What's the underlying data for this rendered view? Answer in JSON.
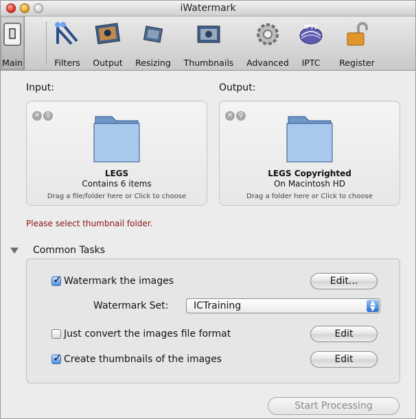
{
  "window": {
    "title": "iWatermark"
  },
  "toolbar": {
    "items": [
      {
        "label": "Main",
        "icon": "switch-icon"
      },
      {
        "label": "Filters",
        "icon": "filters-icon"
      },
      {
        "label": "Output",
        "icon": "output-photo-icon"
      },
      {
        "label": "Resizing",
        "icon": "resizing-icon"
      },
      {
        "label": "Thumbnails",
        "icon": "thumbnails-icon"
      },
      {
        "label": "Advanced",
        "icon": "gear-icon"
      },
      {
        "label": "IPTC",
        "icon": "iptc-icon",
        "badge": "IPTC"
      },
      {
        "label": "Register",
        "icon": "lock-icon"
      }
    ]
  },
  "input": {
    "label": "Input:",
    "name": "LEGS",
    "subtitle": "Contains 6 items",
    "hint": "Drag a file/folder here or Click to choose"
  },
  "output": {
    "label": "Output:",
    "name": "LEGS Copyrighted",
    "subtitle": "On Macintosh HD",
    "hint": "Drag a folder here or Click to choose"
  },
  "warning": "Please select thumbnail folder.",
  "common_tasks": {
    "title": "Common Tasks",
    "watermark": {
      "label": "Watermark the images",
      "checked": true,
      "button": "Edit..."
    },
    "watermark_set": {
      "label": "Watermark Set:",
      "value": "ICTraining"
    },
    "convert": {
      "label": "Just convert the images file format",
      "checked": false,
      "button": "Edit"
    },
    "thumbnails": {
      "label": "Create thumbnails of the images",
      "checked": true,
      "button": "Edit"
    }
  },
  "actions": {
    "start": "Start Processing"
  },
  "colors": {
    "warning": "#8b1414",
    "accent_blue": "#2b6ccf"
  }
}
